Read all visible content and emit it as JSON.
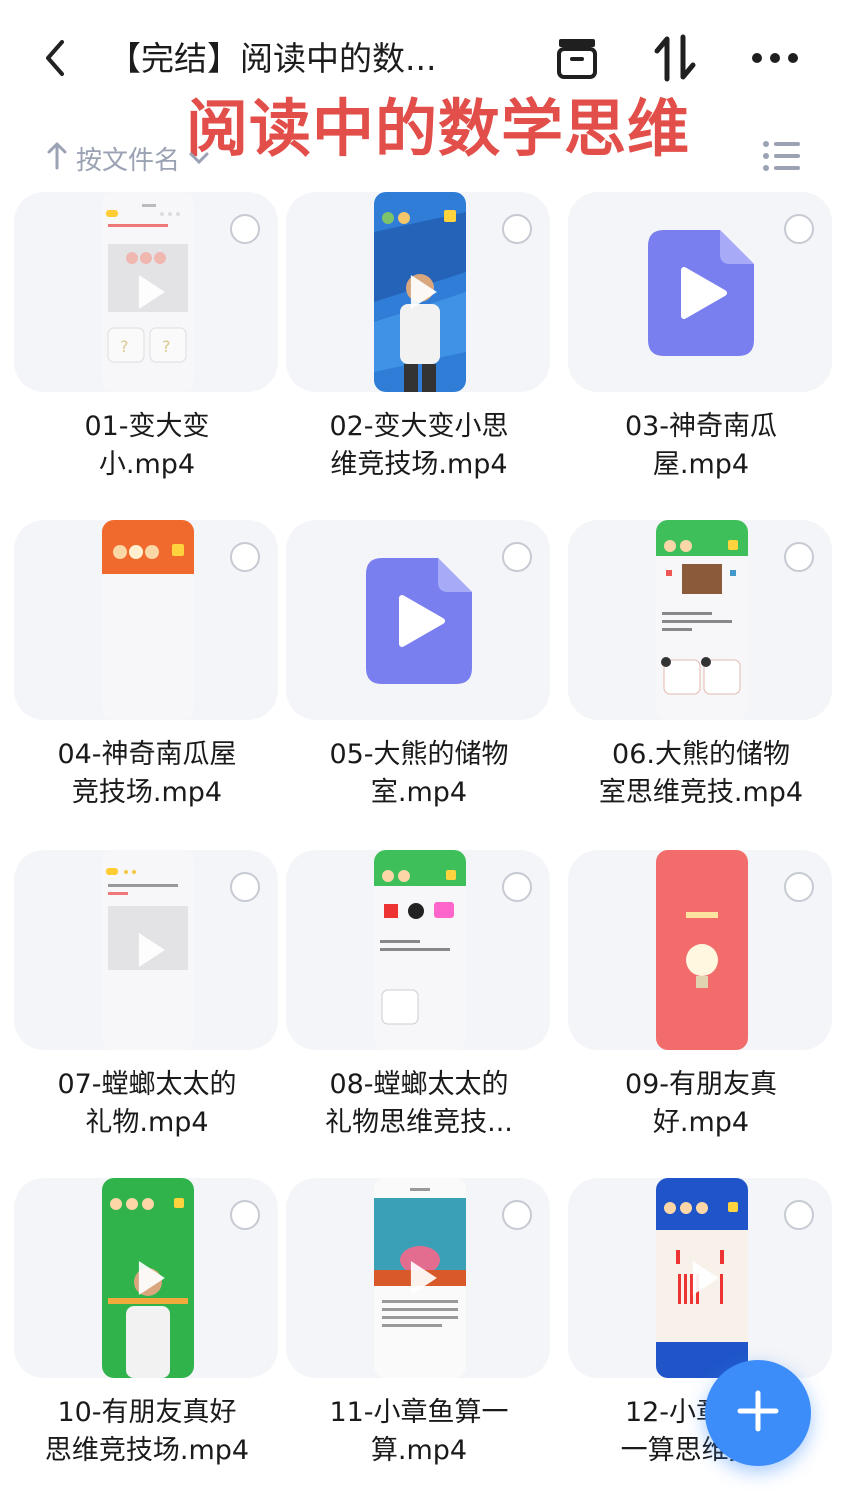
{
  "header": {
    "title": "【完结】阅读中的数...",
    "watermark": "阅读中的数学思维"
  },
  "sort": {
    "label": "按文件名"
  },
  "icons": {
    "back": "chevron-left-icon",
    "archive": "archive-box-icon",
    "sort_order": "sort-arrows-icon",
    "more": "more-dots-icon",
    "list_view": "list-view-icon",
    "add": "plus-icon"
  },
  "colors": {
    "accent": "#3c8cfa",
    "video_icon": "#7a7ff0",
    "watermark": "#e0413b"
  },
  "files": [
    {
      "name": "01-变大变\n小.mp4",
      "thumb": "white-quiz"
    },
    {
      "name": "02-变大变小思\n维竞技场.mp4",
      "thumb": "blue-person"
    },
    {
      "name": "03-神奇南瓜\n屋.mp4",
      "thumb": "video-icon"
    },
    {
      "name": "04-神奇南瓜屋\n竞技场.mp4",
      "thumb": "orange-top"
    },
    {
      "name": "05-大熊的储物\n室.mp4",
      "thumb": "video-icon"
    },
    {
      "name": "06.大熊的储物\n室思维竞技.mp4",
      "thumb": "green-quiz"
    },
    {
      "name": "07-螳螂太太的\n礼物.mp4",
      "thumb": "white-quiz"
    },
    {
      "name": "08-螳螂太太的\n礼物思维竞技...",
      "thumb": "green-shapes"
    },
    {
      "name": "09-有朋友真\n好.mp4",
      "thumb": "coral-bulb"
    },
    {
      "name": "10-有朋友真好\n思维竞技场.mp4",
      "thumb": "green-person"
    },
    {
      "name": "11-小章鱼算一\n算.mp4",
      "thumb": "book-octopus"
    },
    {
      "name": "12-小章鱼算\n一算思维竞...",
      "thumb": "blue-sticks"
    }
  ]
}
